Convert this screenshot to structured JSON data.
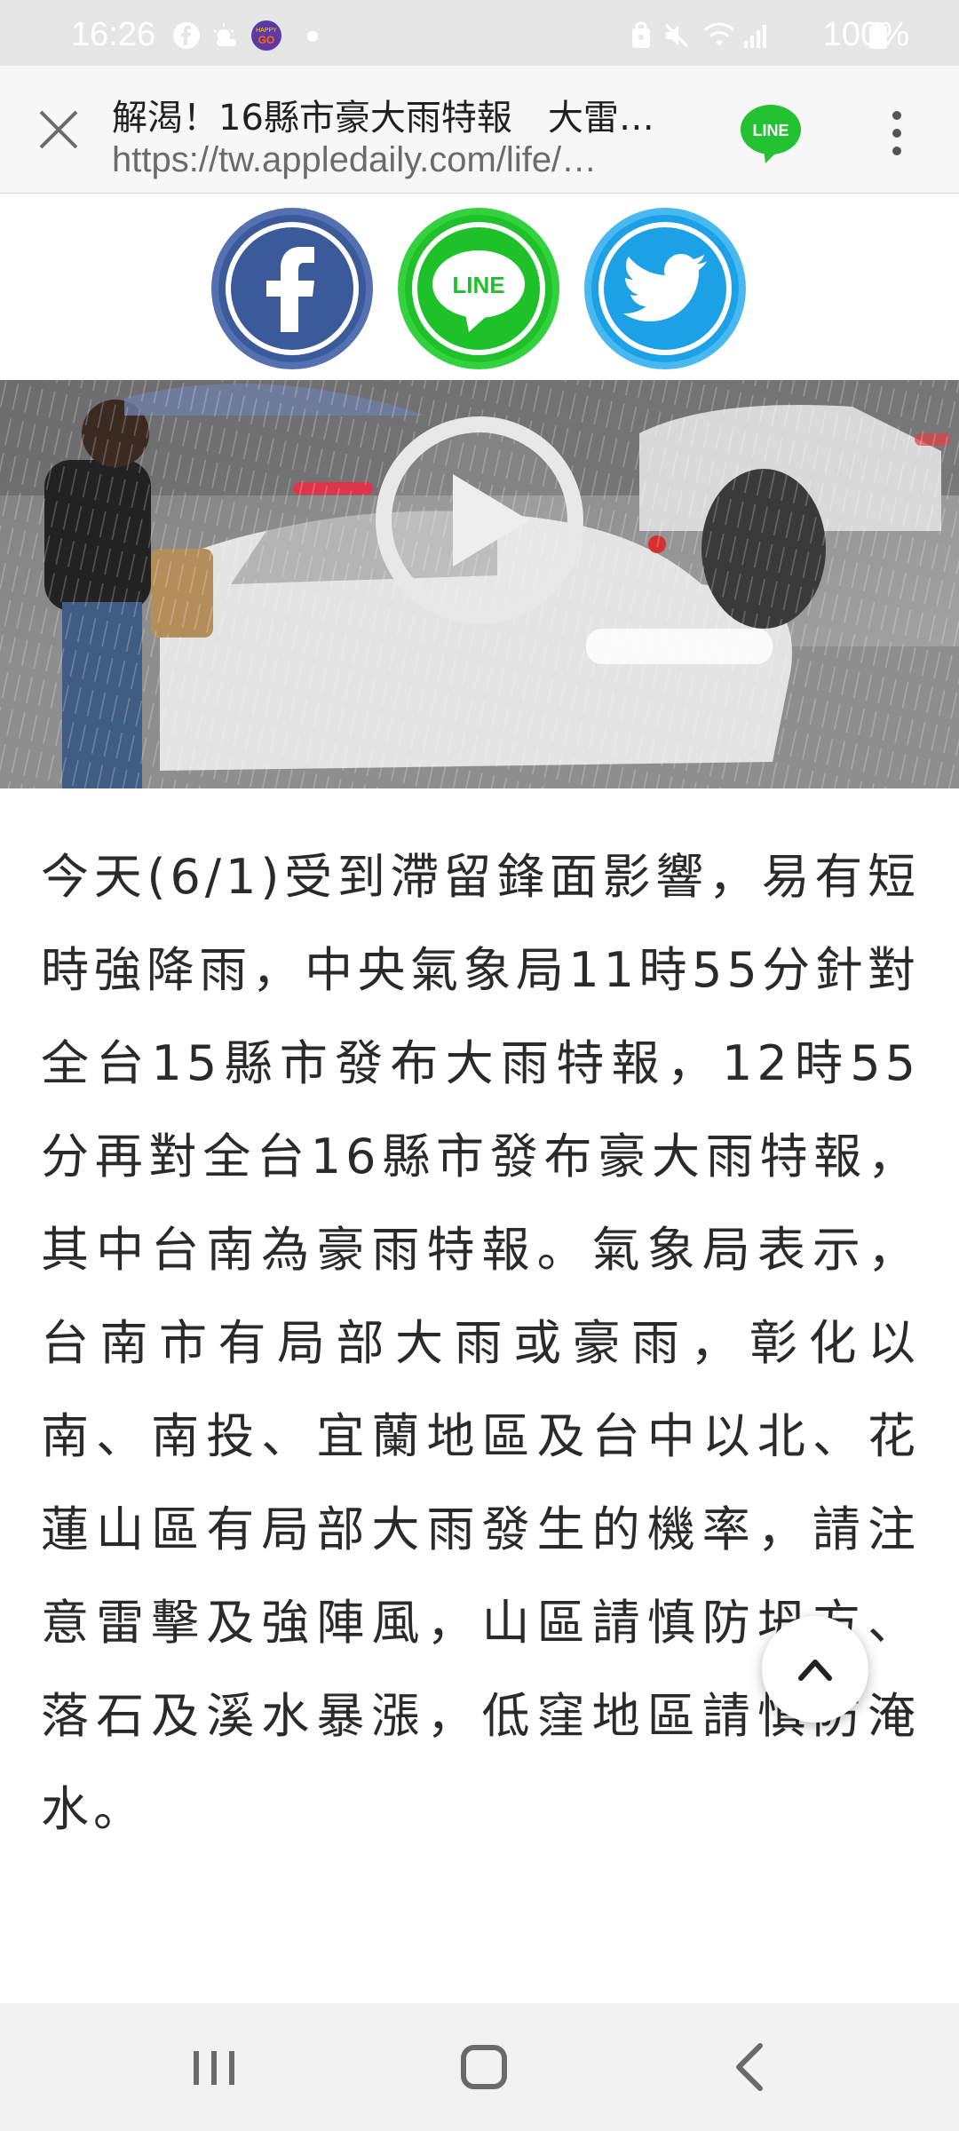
{
  "status_bar": {
    "time": "16:26",
    "battery": "100%",
    "left_icons": [
      "facebook-icon",
      "weather-icon",
      "happy-go-app-icon",
      "dot-icon"
    ],
    "right_icons": [
      "lock-icon",
      "mute-icon",
      "wifi-icon",
      "signal-icon",
      "battery-icon"
    ]
  },
  "browser": {
    "title": "解渴！16縣市豪大雨特報　大雷…",
    "url": "https://tw.appledaily.com/life/…",
    "line_badge": "LINE"
  },
  "share": {
    "line_label": "LINE"
  },
  "video": {
    "play_icon": "play-icon"
  },
  "article": {
    "paragraph": "今天(6/1)受到滯留鋒面影響，易有短時強降雨，中央氣象局11時55分針對全台15縣市發布大雨特報，12時55分再對全台16縣市發布豪大雨特報，其中台南為豪雨特報。氣象局表示，台南市有局部大雨或豪雨，彰化以南、南投、宜蘭地區及台中以北、花蓮山區有局部大雨發生的機率，請注意雷擊及強陣風，山區請慎防坍方、落石及溪水暴漲，低窪地區請慎防淹水。"
  },
  "colors": {
    "facebook": "#3b5a9a",
    "line": "#1fc12a",
    "twitter": "#1da1e6",
    "status_bar": "#e6e6e6",
    "nav_bar": "#f2f2f2"
  }
}
